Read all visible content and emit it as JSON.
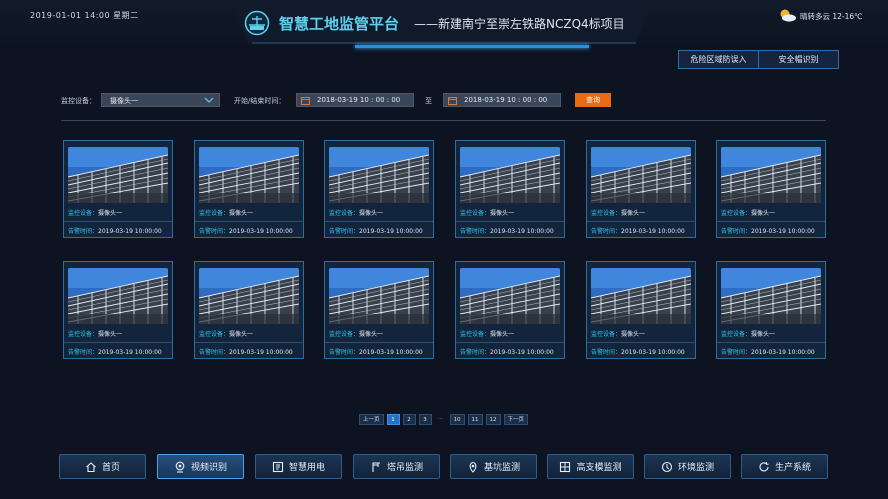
{
  "header": {
    "datetime": "2019-01-01 14:00 星期二",
    "title": "智慧工地监管平台",
    "subtitle": "——新建南宁至崇左铁路NCZQ4标项目",
    "weather": "晴转多云 12-16℃"
  },
  "tabs": [
    {
      "label": "危险区域防误入"
    },
    {
      "label": "安全帽识别"
    }
  ],
  "filter": {
    "device_label": "监控设备：",
    "device_value": "摄像头一",
    "time_label": "开始/结束时间：",
    "start": "2018-03-19  10 : 00 : 00",
    "to": "至",
    "end": "2018-03-19  10 : 00 : 00",
    "query": "查询"
  },
  "card": {
    "device_key": "监控设备：",
    "device_val": "摄像头一",
    "time_key": "告警时间：",
    "time_val": "2019-03-19  10:00:00"
  },
  "pager": {
    "prev": "上一页",
    "pages": [
      "1",
      "2",
      "3"
    ],
    "ellipsis": "···",
    "tail": [
      "10",
      "11",
      "12"
    ],
    "next": "下一页",
    "current": "1"
  },
  "nav": [
    {
      "label": "首页",
      "icon": "home-icon"
    },
    {
      "label": "视频识别",
      "icon": "camera-icon"
    },
    {
      "label": "智慧用电",
      "icon": "power-icon"
    },
    {
      "label": "塔吊监测",
      "icon": "crane-icon"
    },
    {
      "label": "基坑监测",
      "icon": "location-icon"
    },
    {
      "label": "高支模监测",
      "icon": "grid-icon"
    },
    {
      "label": "环境监测",
      "icon": "environment-icon"
    },
    {
      "label": "生产系统",
      "icon": "refresh-icon"
    }
  ],
  "colors": {
    "background": "#0d1320",
    "accent": "#31c1e8",
    "query": "#e86a12",
    "active_page": "#2472c8"
  }
}
